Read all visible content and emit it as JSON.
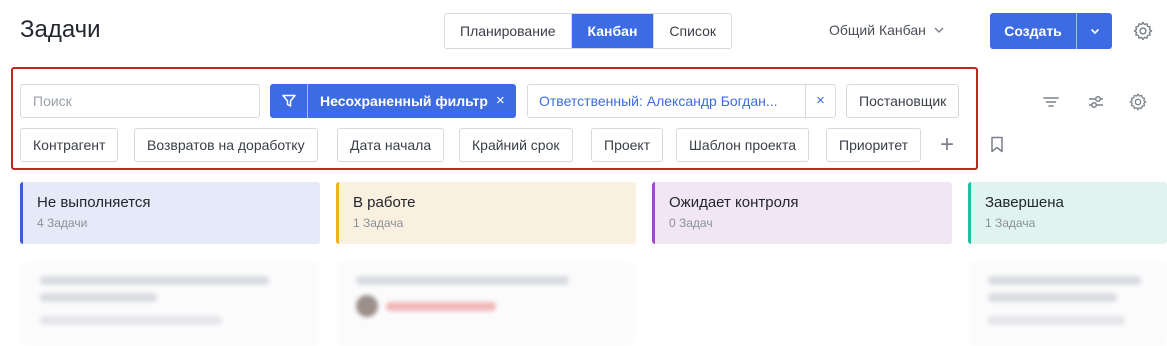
{
  "header": {
    "title": "Задачи",
    "views": [
      {
        "label": "Планирование",
        "active": false
      },
      {
        "label": "Канбан",
        "active": true
      },
      {
        "label": "Список",
        "active": false
      }
    ],
    "board_selector": "Общий Канбан",
    "create_label": "Создать",
    "accent_color": "#3d6be4"
  },
  "filters": {
    "search_placeholder": "Поиск",
    "saved_filter_label": "Несохраненный фильтр",
    "remove_symbol": "×",
    "assignee_filter": "Ответственный: Александр Богдан...",
    "fields": [
      "Постановщик",
      "Контрагент",
      "Возвратов на доработку",
      "Дата начала",
      "Крайний срок",
      "Проект",
      "Шаблон проекта",
      "Приоритет"
    ],
    "add_symbol": "+",
    "highlight_color": "#c0261f"
  },
  "columns": [
    {
      "name": "Не выполняется",
      "count": "4 Задачи",
      "color": "#3d5fd6",
      "bg": "#e6eaf8"
    },
    {
      "name": "В работе",
      "count": "1 Задача",
      "color": "#f1b31b",
      "bg": "#f9f0df"
    },
    {
      "name": "Ожидает контроля",
      "count": "0 Задач",
      "color": "#a24bc7",
      "bg": "#f1e7f4"
    },
    {
      "name": "Завершена",
      "count": "1 Задача",
      "color": "#1fc1a1",
      "bg": "#e1f3ef"
    }
  ]
}
